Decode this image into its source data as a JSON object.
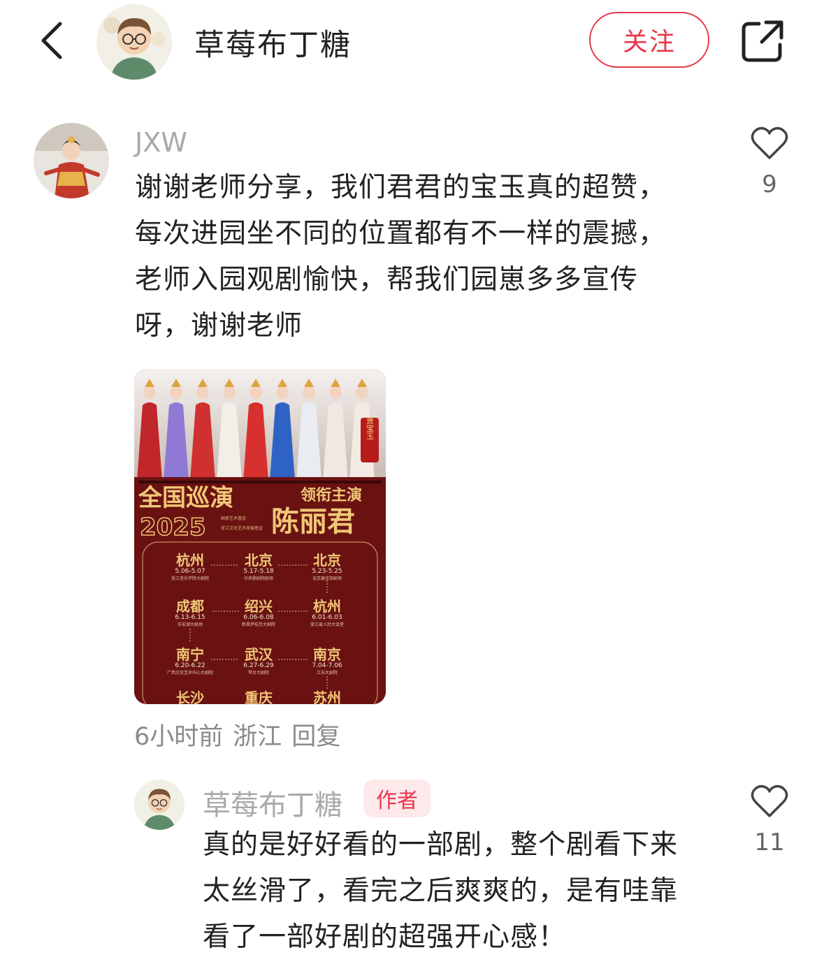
{
  "header": {
    "title": "草莓布丁糖",
    "follow_label": "关注"
  },
  "comment": {
    "username": "JXW",
    "text_lines": [
      "谢谢老师分享，我们君君的宝玉真的超赞，",
      "每次进园坐不同的位置都有不一样的震撼，",
      "老师入园观剧愉快，帮我们园崽多多宣传",
      "呀，谢谢老师"
    ],
    "likes": "9",
    "time": "6小时前",
    "location": "浙江",
    "reply_label": "回复"
  },
  "poster": {
    "side_label": "贾宝玉",
    "tour_title": "全国巡演",
    "year": "2025",
    "lead_label": "领衔主演",
    "lead_name": "陈丽君",
    "org_lines": [
      "国家艺术基金",
      "浙江文化艺术发展基金"
    ],
    "stops": [
      {
        "city": "杭州",
        "dates": "5.06-5.07",
        "venue": "浙江音乐学院大剧院"
      },
      {
        "city": "北京",
        "dates": "5.17-5.18",
        "venue": "中央歌剧院剧场"
      },
      {
        "city": "北京",
        "dates": "5.23-5.25",
        "venue": "北京展览馆剧场"
      },
      {
        "city": "成都",
        "dates": "6.13-6.15",
        "venue": "东安湖大剧场"
      },
      {
        "city": "绍兴",
        "dates": "6.06-6.08",
        "venue": "新昌尹桂芳大剧院"
      },
      {
        "city": "杭州",
        "dates": "6.01-6.03",
        "venue": "浙江省人民大会堂"
      },
      {
        "city": "南宁",
        "dates": "6.20-6.22",
        "venue": "广西文化艺术中心大剧院"
      },
      {
        "city": "武汉",
        "dates": "6.27-6.29",
        "venue": "琴台大剧院"
      },
      {
        "city": "南京",
        "dates": "7.04-7.06",
        "venue": "江苏大剧院"
      },
      {
        "city": "长沙",
        "dates": "",
        "venue": ""
      },
      {
        "city": "重庆",
        "dates": "",
        "venue": ""
      },
      {
        "city": "苏州",
        "dates": "",
        "venue": ""
      }
    ]
  },
  "reply": {
    "username": "草莓布丁糖",
    "badge": "作者",
    "text_lines": [
      "真的是好好看的一部剧，整个剧看下来",
      "太丝滑了，看完之后爽爽的，是有哇靠",
      "看了一部好剧的超强开心感！"
    ],
    "likes": "11"
  },
  "colors": {
    "accent": "#e8364a",
    "poster_bg": "#6a1212",
    "poster_gold": "#f0c777"
  }
}
